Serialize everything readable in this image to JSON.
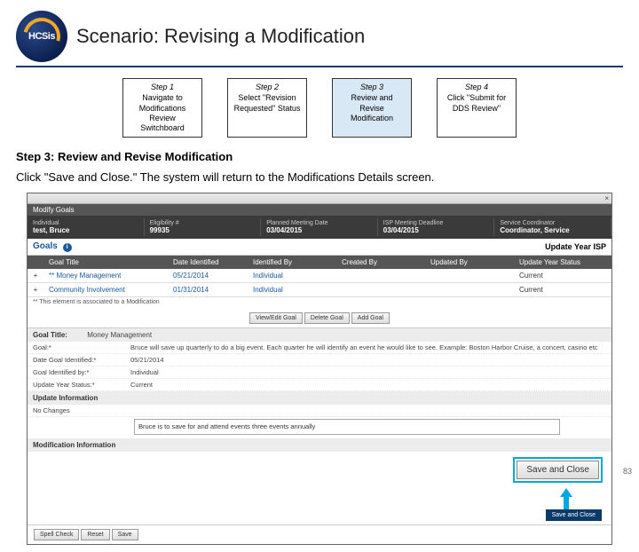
{
  "logo_text": "HCSis",
  "title": "Scenario: Revising a Modification",
  "steps": [
    {
      "name": "Step 1",
      "body": "Navigate to Modifications Review Switchboard",
      "active": false
    },
    {
      "name": "Step 2",
      "body": "Select \"Revision Requested\" Status",
      "active": false
    },
    {
      "name": "Step 3",
      "body": "Review and Revise Modification",
      "active": true
    },
    {
      "name": "Step 4",
      "body": "Click \"Submit for DDS Review\"",
      "active": false
    }
  ],
  "section_heading": "Step 3: Review and Revise Modification",
  "instruction": "Click \"Save and Close.\" The system will return to the Modifications Details screen.",
  "screenshot": {
    "close_x": "×",
    "titlebar": "Modify Goals",
    "dark_cells": [
      {
        "label": "Individual",
        "value": "test, Bruce"
      },
      {
        "label": "Eligibility #",
        "value": "99935"
      },
      {
        "label": "Planned Meeting Date",
        "value": "03/04/2015"
      },
      {
        "label": "ISP Meeting Deadline",
        "value": "03/04/2015"
      },
      {
        "label": "Service Coordinator",
        "value": "Coordinator, Service"
      }
    ],
    "goals_label": "Goals",
    "info_icon": "i",
    "update_year_label": "Update Year ISP",
    "table_headers": [
      "",
      "Goal Title",
      "Date Identified",
      "Identified By",
      "Created By",
      "Updated By",
      "Update Year Status"
    ],
    "rows": [
      {
        "toggle": "+",
        "title": "** Money Management",
        "date": "05/21/2014",
        "idby": "Individual",
        "created": "",
        "updated": "",
        "status": "Current"
      },
      {
        "toggle": "+",
        "title": "Community Involvement",
        "date": "01/31/2014",
        "idby": "Individual",
        "created": "",
        "updated": "",
        "status": "Current"
      }
    ],
    "row_note": "** This element is associated to a Modification",
    "goal_buttons": [
      "View/Edit Goal",
      "Delete Goal",
      "Add Goal"
    ],
    "detail_section_label": "Goal Title:",
    "detail_section_value": "Money Management",
    "kv": [
      {
        "k": "Goal:*",
        "v": "Bruce will save up quarterly to do a big event. Each quarter he will identify an event he would like to see. Example: Boston Harbor Cruise, a concert, casino etc"
      },
      {
        "k": "Date Goal Identified:*",
        "v": "05/21/2014"
      },
      {
        "k": "Goal Identified by:*",
        "v": "Individual"
      },
      {
        "k": "Update Year Status:*",
        "v": "Current"
      }
    ],
    "update_info_header": "Update Information",
    "no_changes": "No Changes",
    "textarea_value": "Bruce is to save for and attend events three events annually",
    "mod_info_header": "Modification Information",
    "save_close": "Save and Close",
    "mini_save_close": "Save and Close",
    "bottom_buttons": [
      "Spell Check",
      "Reset",
      "Save"
    ]
  },
  "page_number": "83"
}
